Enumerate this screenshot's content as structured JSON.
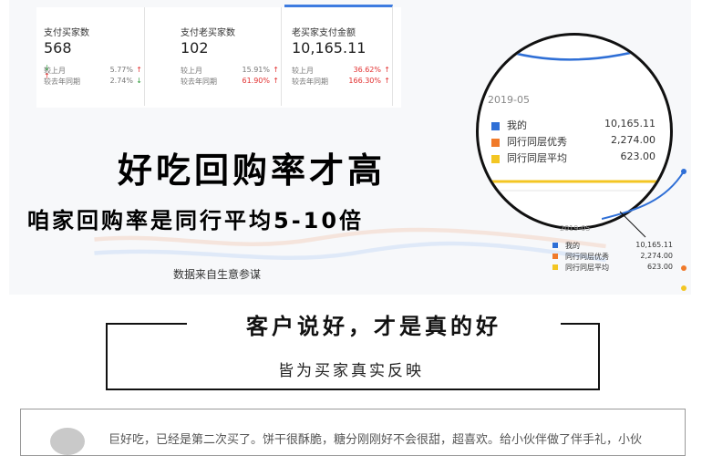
{
  "stats": [
    {
      "title": "支付买家数",
      "value": "568",
      "mom_label": "较上月",
      "mom_value": "5.77%",
      "mom_dir": "up",
      "yoy_label": "较去年同期",
      "yoy_value": "2.74%",
      "yoy_dir": "down"
    },
    {
      "title": "支付老买家数",
      "value": "102",
      "mom_label": "较上月",
      "mom_value": "15.91%",
      "mom_dir": "up",
      "yoy_label": "较去年同期",
      "yoy_value": "61.90%",
      "yoy_dir": "up"
    },
    {
      "title": "老买家支付金额",
      "value": "10,165.11",
      "mom_label": "较上月",
      "mom_value": "36.62%",
      "mom_dir": "up",
      "yoy_label": "较去年同期",
      "yoy_value": "166.30%",
      "yoy_dir": "up"
    }
  ],
  "headline": "好吃回购率才高",
  "subheadline": "咱家回购率是同行平均5-10倍",
  "source_note": "数据来自生意参谋",
  "zoom": {
    "date": "2019-05",
    "legend": [
      {
        "label": "我的",
        "value": "10,165.11",
        "color": "#2f6fd6"
      },
      {
        "label": "同行同层优秀",
        "value": "2,274.00",
        "color": "#f07a2a"
      },
      {
        "label": "同行同层平均",
        "value": "623.00",
        "color": "#f3c623"
      }
    ]
  },
  "mini": {
    "date": "2019-05",
    "legend": [
      {
        "label": "我的",
        "value": "10,165.11",
        "color": "#2f6fd6"
      },
      {
        "label": "同行同层优秀",
        "value": "2,274.00",
        "color": "#f07a2a"
      },
      {
        "label": "同行同层平均",
        "value": "623.00",
        "color": "#f3c623"
      }
    ]
  },
  "section": {
    "title": "客户说好，才是真的好",
    "subtitle": "皆为买家真实反映"
  },
  "review": {
    "text": "巨好吃，已经是第二次买了。饼干很酥脆，糖分刚刚好不会很甜，超喜欢。给小伙伴做了伴手礼，小伙"
  }
}
